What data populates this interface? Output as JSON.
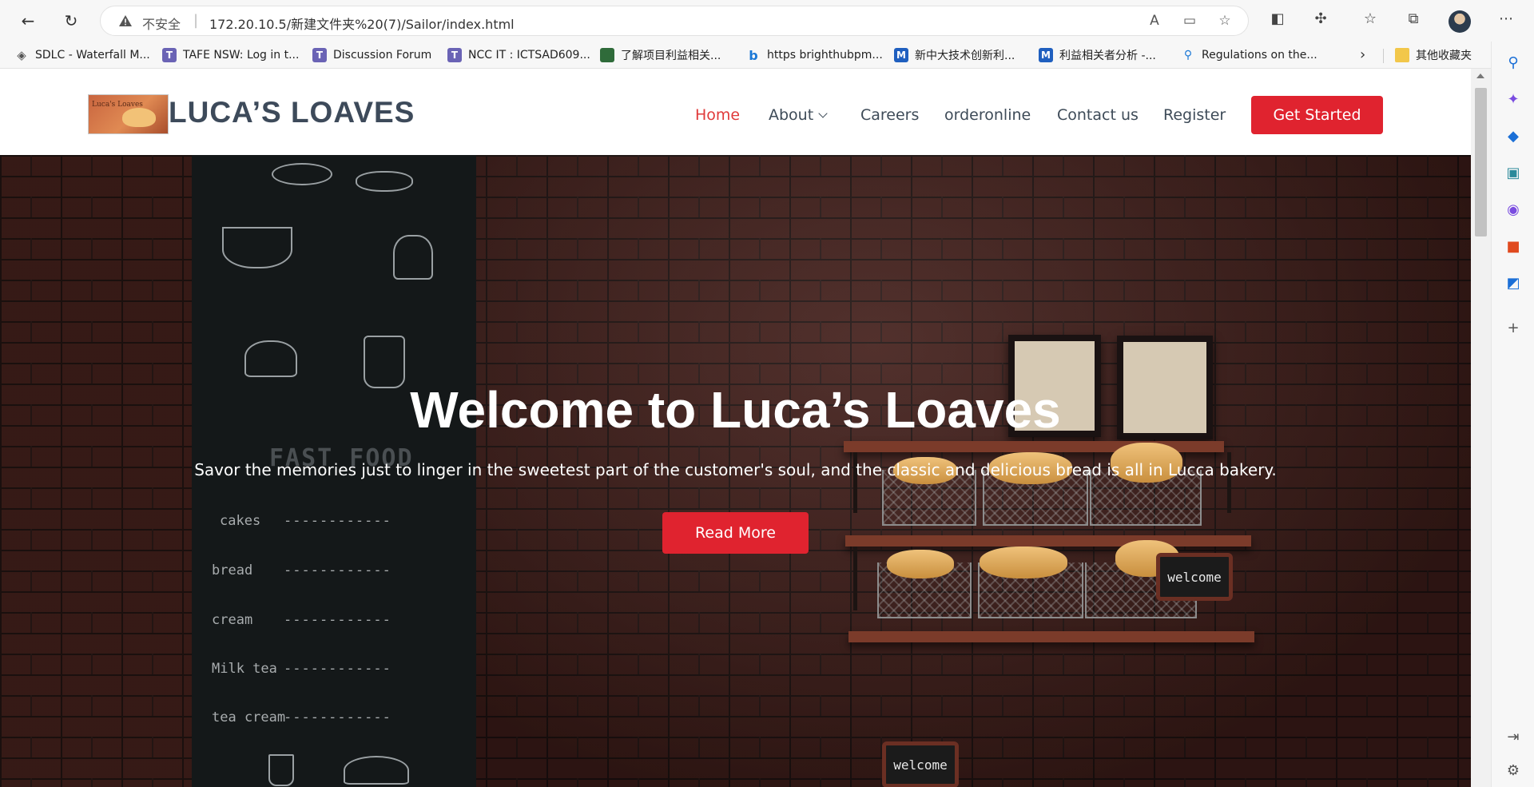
{
  "browser": {
    "url_warning": "不安全",
    "url": "172.20.10.5/新建文件夹%20(7)/Sailor/index.html",
    "bookmarks": [
      {
        "label": "SDLC - Waterfall M..."
      },
      {
        "label": "TAFE NSW: Log in t..."
      },
      {
        "label": "Discussion Forum"
      },
      {
        "label": "NCC IT : ICTSAD609..."
      },
      {
        "label": "了解项目利益相关..."
      },
      {
        "label": "https brighthubpm..."
      },
      {
        "label": "新中大技术创新利..."
      },
      {
        "label": "利益相关者分析 -..."
      },
      {
        "label": "Regulations on the..."
      }
    ],
    "other_bookmarks": "其他收藏夹"
  },
  "site": {
    "brand": "LUCA’S LOAVES",
    "logo_text": "Luca's Loaves",
    "nav": [
      {
        "label": "Home"
      },
      {
        "label": "About"
      },
      {
        "label": "Careers"
      },
      {
        "label": "orderonline"
      },
      {
        "label": "Contact us"
      },
      {
        "label": "Register"
      }
    ],
    "cta": "Get Started",
    "hero": {
      "title": "Welcome to Luca’s Loaves",
      "subtitle": "Savor the memories just to linger in the sweetest part of the customer's soul, and the classic and delicious bread is all in Lucca bakery.",
      "button": "Read More"
    },
    "menu_board": {
      "heading": "FAST FOOD",
      "items": [
        "cakes",
        "bread",
        "cream",
        "Milk tea",
        "tea cream"
      ],
      "dashes": "------------"
    },
    "signs": [
      "welcome",
      "welcome"
    ]
  },
  "colors": {
    "accent": "#e0232f",
    "brand_text": "#3d4a5a"
  }
}
